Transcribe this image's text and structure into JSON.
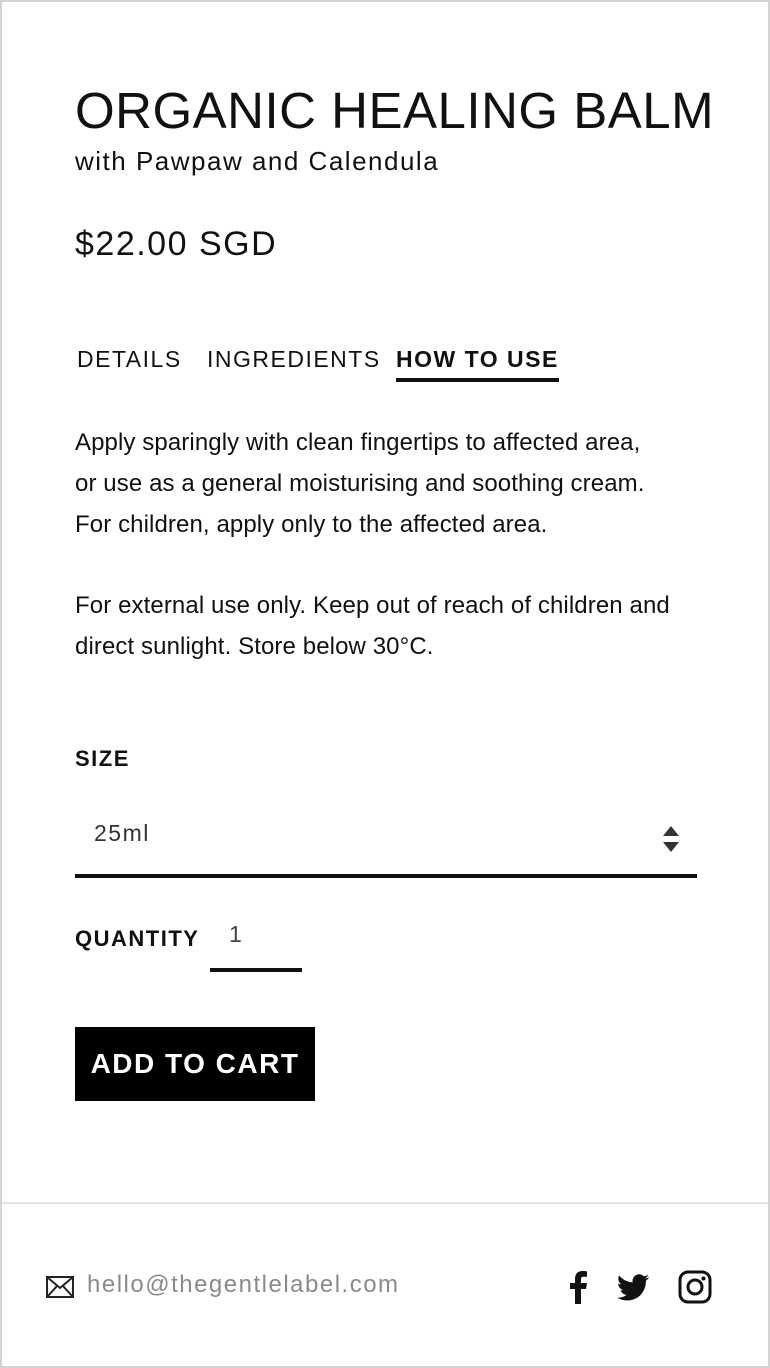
{
  "product": {
    "title": "ORGANIC HEALING BALM",
    "subtitle": "with Pawpaw and Calendula",
    "price": "$22.00 SGD"
  },
  "tabs": [
    {
      "label": "DETAILS",
      "active": false
    },
    {
      "label": "INGREDIENTS",
      "active": false
    },
    {
      "label": "HOW TO USE",
      "active": true
    }
  ],
  "how_to_use": {
    "paragraph_1_lines": [
      "Apply sparingly with clean fingertips to affected area,",
      "or use as a general moisturising and soothing cream.",
      "For children, apply only to the affected area."
    ],
    "paragraph_2_lines": [
      "For external use only. Keep out of reach of children and",
      "direct sunlight. Store below 30°C."
    ]
  },
  "size": {
    "label": "SIZE",
    "selected": "25ml"
  },
  "quantity": {
    "label": "QUANTITY",
    "value": "1"
  },
  "cart_button": {
    "label": "ADD TO CART"
  },
  "footer": {
    "email": "hello@thegentlelabel.com",
    "email_icon": "mail-icon",
    "social_icons": [
      "facebook-icon",
      "twitter-icon",
      "instagram-icon"
    ]
  },
  "colors": {
    "text": "#111111",
    "button_bg": "#000000",
    "button_text": "#ffffff",
    "muted": "#8a8a8a",
    "border": "#d4d4d4"
  }
}
